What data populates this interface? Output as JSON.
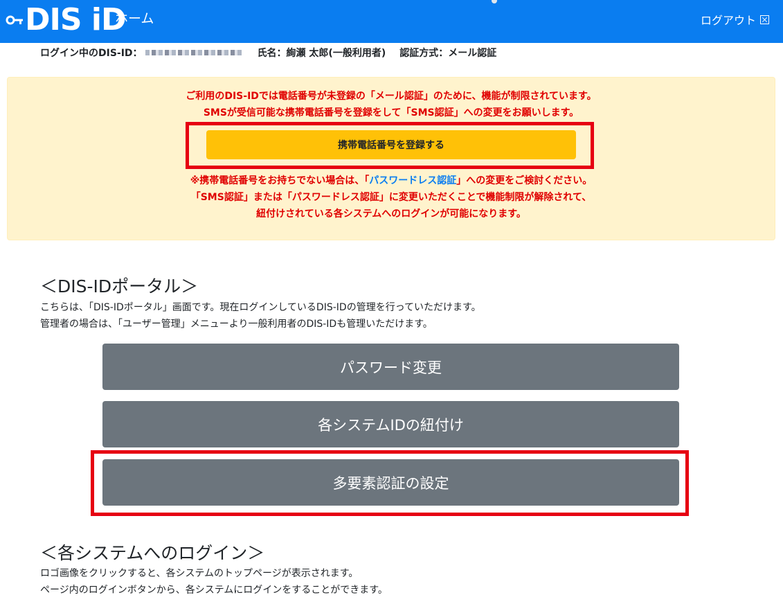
{
  "header": {
    "logo_text": "DIS iD",
    "nav_home": "ホーム",
    "logout_label": "ログアウト"
  },
  "userbar": {
    "id_label": "ログイン中のDIS-ID：",
    "name_label": "氏名：絢瀬 太郎(一般利用者)",
    "auth_label": "認証方式：メール認証"
  },
  "alert": {
    "line1": "ご利用のDIS-IDでは電話番号が未登録の「メール認証」のために、機能が制限されています。",
    "line2": "SMSが受信可能な携帯電話番号を登録をして「SMS認証」への変更をお願いします。",
    "register_button": "携帯電話番号を登録する",
    "line3_pre": "※携帯電話番号をお持ちでない場合は、「",
    "line3_link": "パスワードレス認証",
    "line3_post": "」への変更をご検討ください。",
    "line4": "「SMS認証」または「パスワードレス認証」に変更いただくことで機能制限が解除されて、",
    "line5": "紐付けされている各システムへのログインが可能になります。"
  },
  "portal": {
    "title": "＜DIS-IDポータル＞",
    "desc1": "こちらは、「DIS-IDポータル」画面です。現在ログインしているDIS-IDの管理を行っていただけます。",
    "desc2": "管理者の場合は、「ユーザー管理」メニューより一般利用者のDIS-IDも管理いただけます。",
    "buttons": [
      "パスワード変更",
      "各システムIDの紐付け",
      "多要素認証の設定"
    ]
  },
  "systems": {
    "title": "＜各システムへのログイン＞",
    "desc1": "ロゴ画像をクリックすると、各システムのトップページが表示されます。",
    "desc2": "ページ内のログインボタンから、各システムにログインをすることができます。"
  },
  "colors": {
    "header_bg": "#0a7df0",
    "alert_bg": "#fff3cd",
    "alert_text": "#e00000",
    "register_button": "#ffc107",
    "portal_button": "#6c757d",
    "highlight_outline": "#e60012"
  }
}
